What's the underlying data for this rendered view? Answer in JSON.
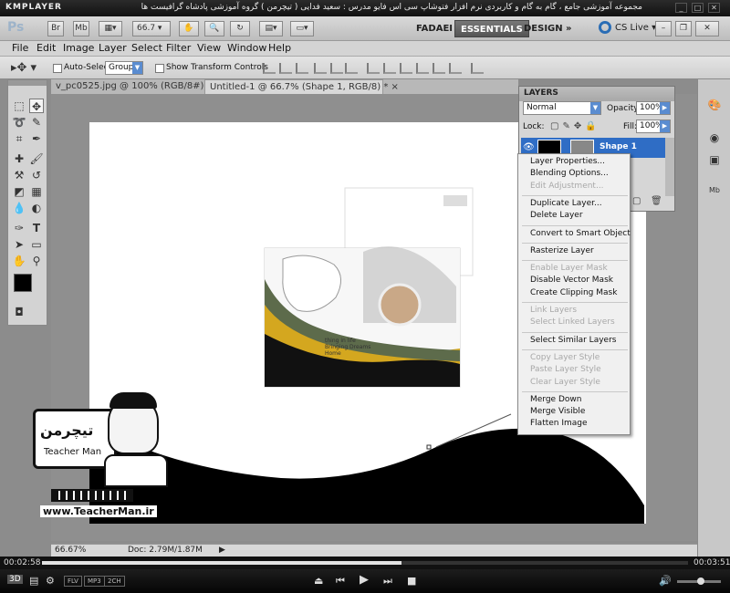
{
  "player": {
    "app_name": "KMPLAYER",
    "video_title": "مجموعه آموزشی جامع ، گام به گام و کاربردی نرم افزار فتوشاپ سی اس فایو   مدرس : سعید فدایی ( تیچرمن ) گروه آموزشی پادشاه گرافیست ها",
    "time_current": "00:02:58",
    "time_total": "00:03:51",
    "progress": 0.556,
    "badges": [
      "FLV",
      "MP3",
      "2CH"
    ],
    "window_buttons": [
      "_",
      "□",
      "✕"
    ]
  },
  "ps_appbar": {
    "logo": "Ps",
    "buttons": [
      "Br",
      "Mb"
    ],
    "zoom": "66.7",
    "workspaces": [
      "FADAEI",
      "ESSENTIALS",
      "DESIGN"
    ],
    "active_workspace": "ESSENTIALS",
    "more": "»",
    "cs_live": "CS Live"
  },
  "menu": [
    "File",
    "Edit",
    "Image",
    "Layer",
    "Select",
    "Filter",
    "View",
    "Window",
    "Help"
  ],
  "options": {
    "auto_select_label": "Auto-Select:",
    "auto_select_value": "Group",
    "show_transform_label": "Show Transform Controls"
  },
  "tabs": [
    {
      "label": "v_pc0525.jpg @ 100% (RGB/8#)",
      "close": "×"
    },
    {
      "label": "Untitled-1 @ 66.7% (Shape 1, RGB/8) *",
      "close": "×"
    }
  ],
  "status": {
    "zoom": "66.67%",
    "doc": "Doc: 2.79M/1.87M"
  },
  "layers_panel": {
    "title": "LAYERS",
    "blend_mode": "Normal",
    "opacity_label": "Opacity:",
    "opacity_value": "100%",
    "lock_label": "Lock:",
    "fill_label": "Fill:",
    "fill_value": "100%",
    "layer_name": "Shape 1"
  },
  "context_menu": {
    "groups": [
      [
        {
          "label": "Layer Properties...",
          "enabled": true
        },
        {
          "label": "Blending Options...",
          "enabled": true
        },
        {
          "label": "Edit Adjustment...",
          "enabled": false
        }
      ],
      [
        {
          "label": "Duplicate Layer...",
          "enabled": true
        },
        {
          "label": "Delete Layer",
          "enabled": true
        }
      ],
      [
        {
          "label": "Convert to Smart Object",
          "enabled": true
        }
      ],
      [
        {
          "label": "Rasterize Layer",
          "enabled": true
        }
      ],
      [
        {
          "label": "Enable Layer Mask",
          "enabled": false
        },
        {
          "label": "Disable Vector Mask",
          "enabled": true
        },
        {
          "label": "Create Clipping Mask",
          "enabled": true
        }
      ],
      [
        {
          "label": "Link Layers",
          "enabled": false
        },
        {
          "label": "Select Linked Layers",
          "enabled": false
        }
      ],
      [
        {
          "label": "Select Similar Layers",
          "enabled": true
        }
      ],
      [
        {
          "label": "Copy Layer Style",
          "enabled": false
        },
        {
          "label": "Paste Layer Style",
          "enabled": false
        },
        {
          "label": "Clear Layer Style",
          "enabled": false
        }
      ],
      [
        {
          "label": "Merge Down",
          "enabled": true
        },
        {
          "label": "Merge Visible",
          "enabled": true
        },
        {
          "label": "Flatten Image",
          "enabled": true
        }
      ]
    ]
  },
  "artwork": {
    "brochure_text_1": "thing in life",
    "brochure_text_2": "Bringing Dreams",
    "brochure_text_3": "Home"
  },
  "watermark": {
    "logo_text": "تیچرمن",
    "caption": "Teacher Man",
    "url": "www.TeacherMan.ir"
  }
}
